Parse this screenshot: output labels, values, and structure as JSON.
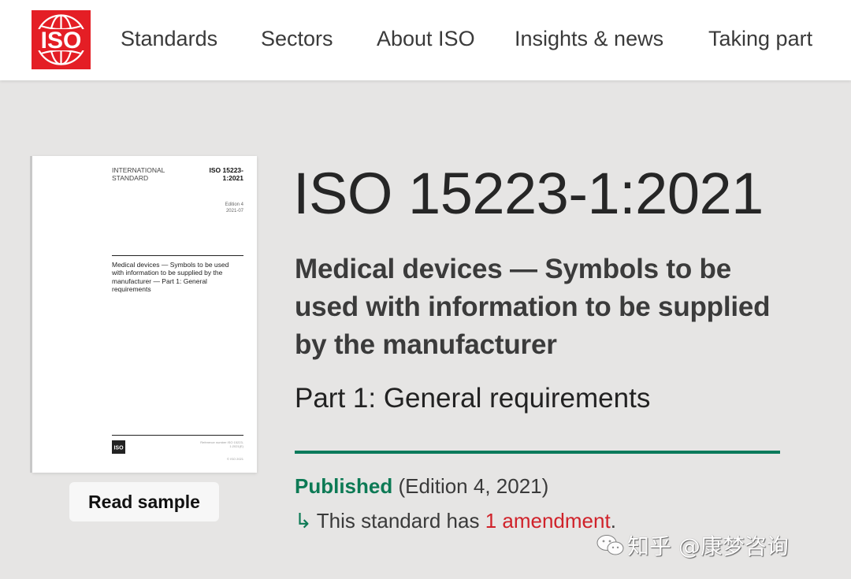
{
  "header": {
    "logo_text": "ISO",
    "nav": [
      {
        "label": "Standards"
      },
      {
        "label": "Sectors"
      },
      {
        "label": "About ISO"
      },
      {
        "label": "Insights & news"
      },
      {
        "label": "Taking part"
      }
    ]
  },
  "cover": {
    "line1": "INTERNATIONAL",
    "line2": "STANDARD",
    "number_line1": "ISO 15223-",
    "number_line2": "1:2021",
    "edition_line1": "Edition 4",
    "edition_line2": "2021-07",
    "title": "Medical devices — Symbols to be used with information to be supplied by the manufacturer — Part 1: General requirements",
    "mini_logo_text": "ISO",
    "ref_text": "Reference number ISO 15223-1:2021(E)",
    "copyright": "© ISO 2021"
  },
  "read_sample_label": "Read sample",
  "standard": {
    "title": "ISO 15223-1:2021",
    "subtitle": "Medical devices — Symbols to be used with information to be supplied by the manufacturer",
    "part": "Part 1: General requirements",
    "status_label": "Published",
    "edition_text": "(Edition 4, 2021)",
    "amendment_arrow": "↳",
    "amendment_prefix": "This standard has",
    "amendment_link": "1 amendment",
    "amendment_suffix": "."
  },
  "watermark": {
    "text": "知乎 @康梦咨询",
    "icon": "wechat-icon"
  },
  "colors": {
    "brand_red": "#e41e25",
    "published_green": "#0d7a55",
    "link_red": "#d0222a"
  }
}
